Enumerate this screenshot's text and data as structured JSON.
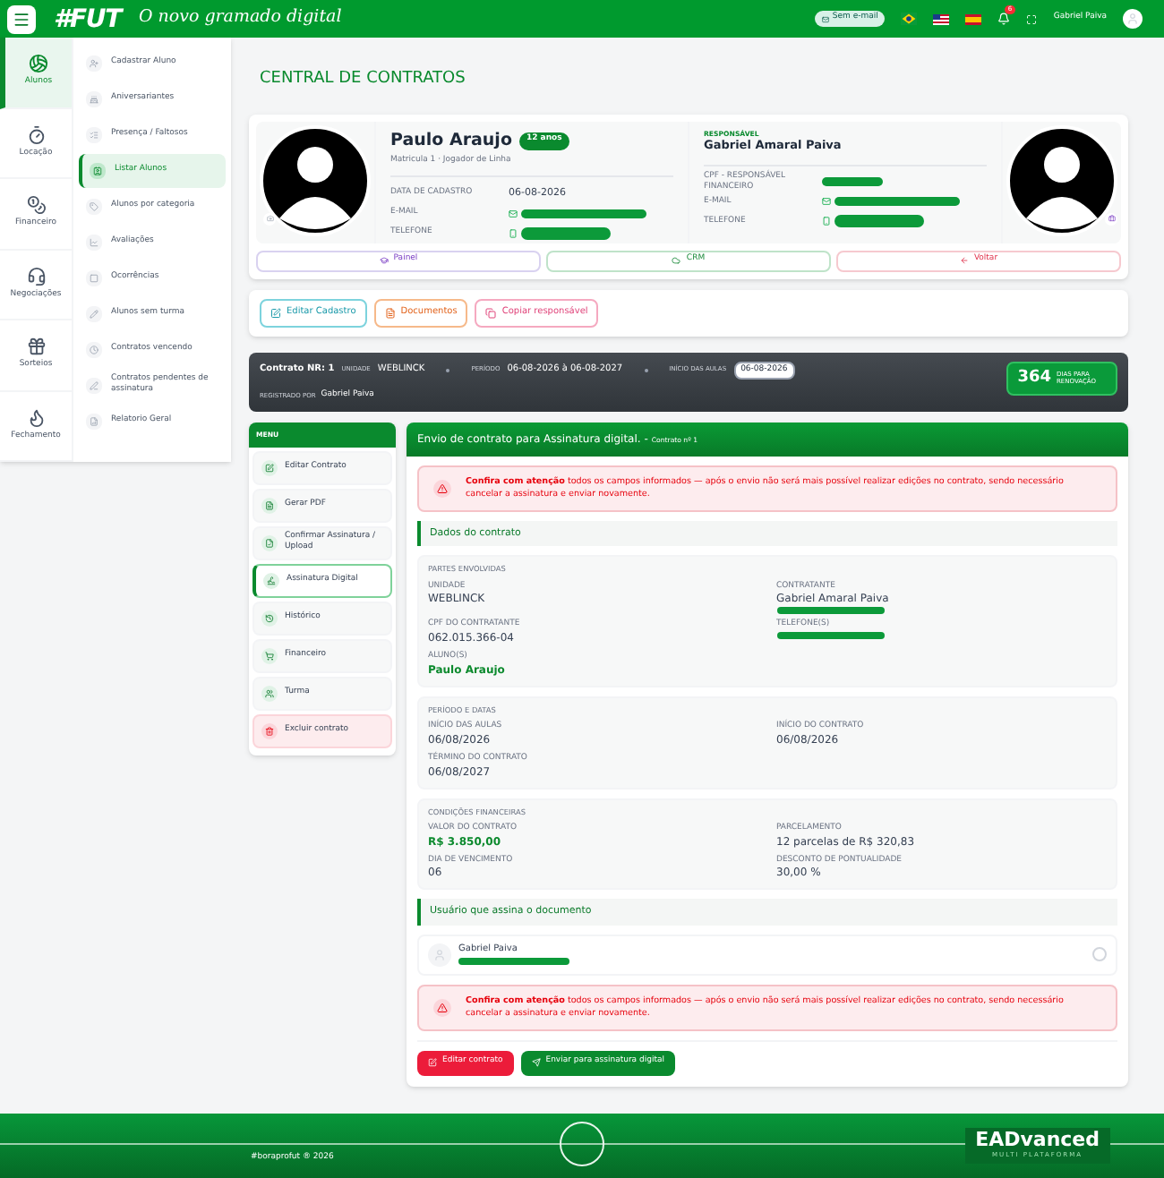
{
  "header": {
    "logo": "#FUT",
    "tagline": "O novo gramado digital",
    "email_button": "Sem e-mail",
    "notification_count": "6",
    "user_name": "Gabriel Paiva"
  },
  "rail": [
    {
      "label": "Alunos",
      "kind": "ball",
      "selected": true
    },
    {
      "label": "Locação",
      "kind": "timer",
      "selected": false
    },
    {
      "label": "Financeiro",
      "kind": "coins",
      "selected": false
    },
    {
      "label": "Negociações",
      "kind": "headset",
      "selected": false
    },
    {
      "label": "Sorteios",
      "kind": "gift",
      "selected": false
    },
    {
      "label": "Fechamento",
      "kind": "flame",
      "selected": false
    }
  ],
  "submenu": [
    {
      "label": "Cadastrar Aluno",
      "selected": false
    },
    {
      "label": "Aniversariantes",
      "selected": false
    },
    {
      "label": "Presença / Faltosos",
      "selected": false
    },
    {
      "label": "Listar Alunos",
      "selected": true
    },
    {
      "label": "Alunos por categoria",
      "selected": false
    },
    {
      "label": "Avaliações",
      "selected": false
    },
    {
      "label": "Ocorrências",
      "selected": false
    },
    {
      "label": "Alunos sem turma",
      "selected": false
    },
    {
      "label": "Contratos vencendo",
      "selected": false
    },
    {
      "label": "Contratos pendentes de assinatura",
      "selected": false
    },
    {
      "label": "Relatorio Geral",
      "selected": false
    }
  ],
  "page_title": "CENTRAL DE CONTRATOS",
  "student": {
    "name": "Paulo Araujo",
    "age_badge": "12 anos",
    "subtitle": "Matricula 1 · Jogador de Linha",
    "fields": [
      {
        "label": "DATA DE CADASTRO",
        "kind": "text",
        "value": "06-08-2026"
      },
      {
        "label": "E-MAIL",
        "kind": "email"
      },
      {
        "label": "TELEFONE",
        "kind": "phone"
      }
    ]
  },
  "responsible": {
    "heading": "RESPONSÁVEL",
    "name": "Gabriel Amaral Paiva",
    "fields": [
      {
        "label": "CPF - RESPONSÁVEL FINANCEIRO",
        "kind": "plain"
      },
      {
        "label": "E-MAIL",
        "kind": "email"
      },
      {
        "label": "TELEFONE",
        "kind": "phone"
      }
    ]
  },
  "nav_buttons": [
    {
      "label": "Painel",
      "kind": "panel"
    },
    {
      "label": "CRM",
      "kind": "crm"
    },
    {
      "label": "Voltar",
      "kind": "back"
    }
  ],
  "actions": [
    {
      "label": "Editar Cadastro",
      "kind": "edit"
    },
    {
      "label": "Documentos",
      "kind": "docs"
    },
    {
      "label": "Copiar responsável",
      "kind": "copy"
    }
  ],
  "contract_bar": {
    "number_label": "Contrato NR:",
    "number": "1",
    "unit_label": "UNIDADE",
    "unit": "WEBLINCK",
    "period_label": "PERÍODO",
    "period": "06-08-2026 à 06-08-2027",
    "start_label": "INÍCIO DAS AULAS",
    "start": "06-08-2026",
    "registered_label": "REGISTRADO POR",
    "registered_by": "Gabriel Paiva",
    "days": "364",
    "days_label": "DIAS PARA RENOVAÇÃO"
  },
  "contract_menu": {
    "title": "MENU",
    "items": [
      {
        "label": "Editar Contrato",
        "kind": "edit",
        "selected": false
      },
      {
        "label": "Gerar PDF",
        "kind": "pdf",
        "selected": false
      },
      {
        "label": "Confirmar Assinatura / Upload",
        "kind": "upload",
        "selected": false
      },
      {
        "label": "Assinatura Digital",
        "kind": "sign",
        "selected": true
      },
      {
        "label": "Histórico",
        "kind": "history",
        "selected": false
      },
      {
        "label": "Financeiro",
        "kind": "cart",
        "selected": false
      },
      {
        "label": "Turma",
        "kind": "group",
        "selected": false
      },
      {
        "label": "Excluir contrato",
        "kind": "delete",
        "selected": false
      }
    ]
  },
  "panel": {
    "title": "Envio de contrato para Assinatura digital.",
    "title_separator": "-",
    "subtitle": "Contrato nº 1",
    "alert_top": "**Confira com atenção** todos os campos informados — após o envio não será mais possível realizar edições no contrato, sendo necessário cancelar a assinatura e enviar novamente.",
    "section_title": "Dados do contrato",
    "groups": [
      {
        "title": "PARTES ENVOLVIDAS",
        "fields": [
          {
            "label": "UNIDADE",
            "kind": "text",
            "value": "WEBLINCK"
          },
          {
            "label": "CONTRATANTE",
            "kind": "text_redacted",
            "value": "Gabriel Amaral Paiva"
          },
          {
            "label": "CPF DO CONTRATANTE",
            "kind": "text",
            "value": "062.015.366-04"
          },
          {
            "label": "TELEFONE(S)",
            "kind": "redacted"
          },
          {
            "label": "ALUNO(S)",
            "kind": "highlight",
            "value": "Paulo Araujo"
          }
        ]
      },
      {
        "title": "PERÍODO E DATAS",
        "fields": [
          {
            "label": "INÍCIO DAS AULAS",
            "kind": "text",
            "value": "06/08/2026"
          },
          {
            "label": "INÍCIO DO CONTRATO",
            "kind": "text",
            "value": "06/08/2026"
          },
          {
            "label": "TÉRMINO DO CONTRATO",
            "kind": "text",
            "value": "06/08/2027"
          }
        ]
      },
      {
        "title": "CONDIÇÕES FINANCEIRAS",
        "fields": [
          {
            "label": "VALOR DO CONTRATO",
            "kind": "highlight",
            "value": "R$ 3.850,00"
          },
          {
            "label": "PARCELAMENTO",
            "kind": "text",
            "value": "12 parcelas de R$ 320,83"
          },
          {
            "label": "DIA DE VENCIMENTO",
            "kind": "text",
            "value": "06"
          },
          {
            "label": "DESCONTO DE PONTUALIDADE",
            "kind": "text",
            "value": "30,00 %"
          }
        ]
      }
    ],
    "signer_title": "Usuário que assina o documento",
    "signers": [
      {
        "name": "Gabriel Paiva",
        "selected": false
      }
    ],
    "alert_bottom": "**Confira com atenção** todos os campos informados — após o envio não será mais possível realizar edições no contrato, sendo necessário cancelar a assinatura e enviar novamente.",
    "buttons": [
      {
        "label": "Editar contrato",
        "kind": "danger"
      },
      {
        "label": "Enviar para assinatura digital",
        "kind": "primary"
      }
    ]
  },
  "footer": {
    "copyright": "#boraprofut ® 2026",
    "brand": "EADvanced",
    "brand_sub": "MULTI PLATAFORMA"
  }
}
